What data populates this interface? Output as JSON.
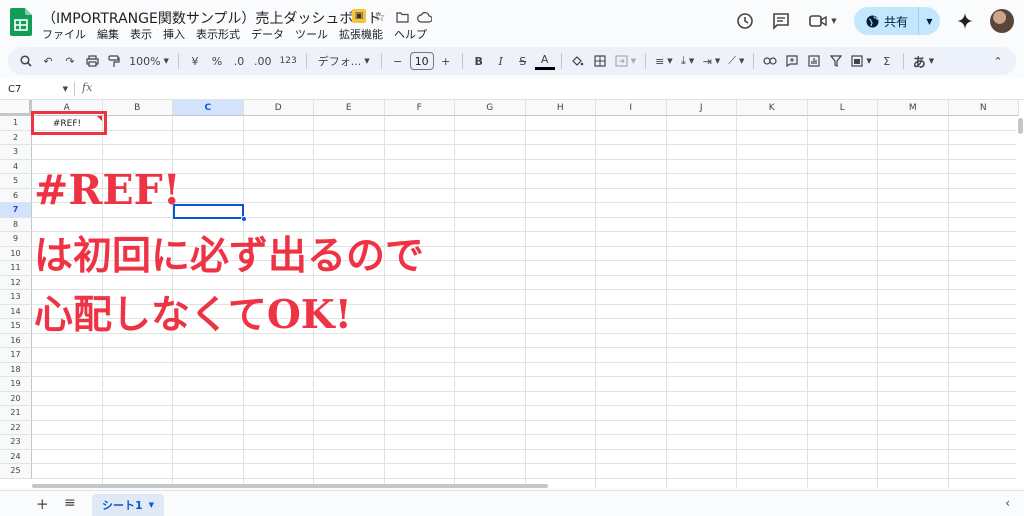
{
  "title": {
    "doc_title": "（IMPORTRANGE関数サンプル）売上ダッシュボード",
    "menu": [
      "ファイル",
      "編集",
      "表示",
      "挿入",
      "表示形式",
      "データ",
      "ツール",
      "拡張機能",
      "ヘルプ"
    ],
    "share_label": "共有",
    "icons": [
      "sheets-logo-icon",
      "slides-badge-icon",
      "star-icon",
      "move-folder-icon",
      "cloud-status-icon",
      "history-icon",
      "comment-icon",
      "meet-icon",
      "globe-icon",
      "gemini-icon",
      "avatar"
    ]
  },
  "toolbar": {
    "zoom": "100%",
    "currency": "¥",
    "percent": "%",
    "dec_decrease": ".0",
    "dec_increase": ".00",
    "number_format": "123",
    "font": "デフォ...",
    "font_minus": "−",
    "font_size": "10",
    "font_plus": "+",
    "bold": "B",
    "italic": "I",
    "strike": "S",
    "text_color": "A",
    "input_tool": "あ",
    "sum": "Σ"
  },
  "formula_bar": {
    "name_box": "C7",
    "fx": "fx",
    "value": ""
  },
  "grid": {
    "columns": [
      "A",
      "B",
      "C",
      "D",
      "E",
      "F",
      "G",
      "H",
      "I",
      "J",
      "K",
      "L",
      "M",
      "N"
    ],
    "rows": [
      "1",
      "2",
      "3",
      "4",
      "5",
      "6",
      "7",
      "8",
      "9",
      "10",
      "11",
      "12",
      "13",
      "14",
      "15",
      "16",
      "17",
      "18",
      "19",
      "20",
      "21",
      "22",
      "23",
      "24",
      "25"
    ],
    "selected_column": "C",
    "selected_row": "7",
    "cell_a1": "#REF!"
  },
  "annotation": {
    "line1": "#REF!",
    "line2": "は初回に必ず出るので",
    "line3": "心配しなくてOK!",
    "color": "#ee3344"
  },
  "sheets": {
    "tabs": [
      "シート1"
    ],
    "active": "シート1"
  }
}
